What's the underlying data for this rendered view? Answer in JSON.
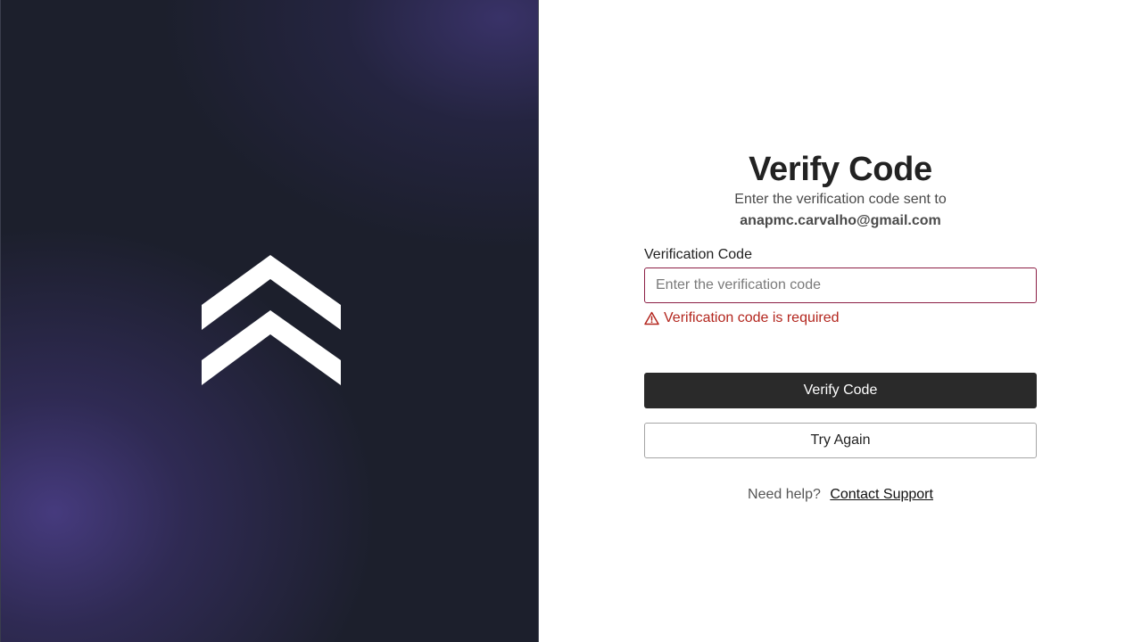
{
  "brand": {
    "logo_icon": "double-chevron-up-icon",
    "panel_colors": {
      "base": "#1c1f2c",
      "glow": "#483c82"
    }
  },
  "form": {
    "title": "Verify Code",
    "subtitle": "Enter the verification code sent to",
    "email": "anapmc.carvalho@gmail.com",
    "code_field": {
      "label": "Verification Code",
      "value": "",
      "placeholder": "Enter the verification code",
      "error_icon": "warning-triangle-icon",
      "error_text": "Verification code is required",
      "error_color": "#b3261e"
    },
    "verify_button": "Verify Code",
    "try_again_button": "Try Again",
    "help": {
      "text": "Need help?",
      "link": "Contact Support"
    }
  }
}
